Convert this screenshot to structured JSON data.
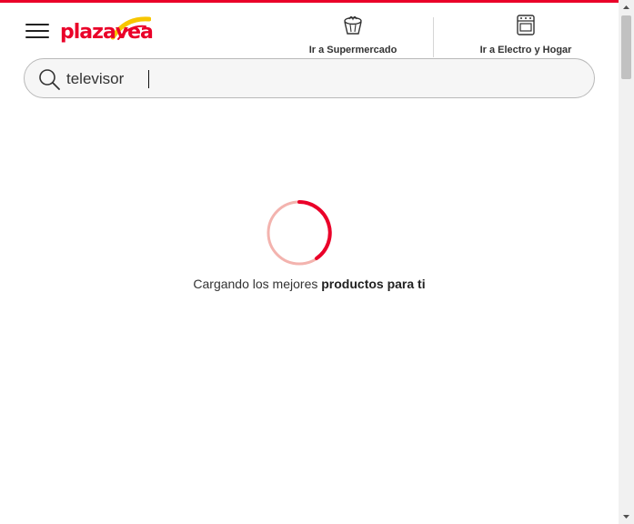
{
  "header": {
    "logo_text": "plazavea",
    "nav": [
      {
        "label": "Ir a Supermercado",
        "icon": "basket-icon"
      },
      {
        "label": "Ir a Electro y Hogar",
        "icon": "stove-icon"
      }
    ]
  },
  "search": {
    "value": "televisor"
  },
  "loading": {
    "text_normal": "Cargando los mejores ",
    "text_bold": "productos para ti"
  },
  "colors": {
    "brand_red": "#ea0029",
    "brand_yellow": "#f7c600",
    "spinner_track": "#f3b3ae"
  }
}
